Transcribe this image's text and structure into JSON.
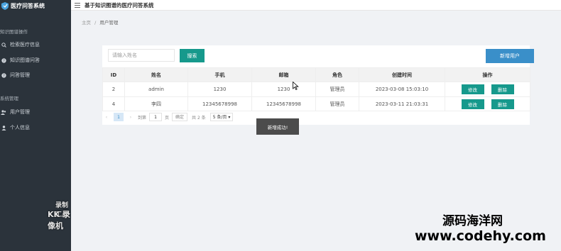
{
  "sidebar": {
    "app_title": "医疗问答系统",
    "groups": [
      {
        "title": "知识图谱操作",
        "items": [
          {
            "label": "检索医疗信息",
            "icon": "search-icon"
          },
          {
            "label": "知识图谱问答",
            "icon": "question-icon"
          },
          {
            "label": "问答管理",
            "icon": "question-icon"
          }
        ]
      },
      {
        "title": "系统管理",
        "items": [
          {
            "label": "用户管理",
            "icon": "users-icon"
          },
          {
            "label": "个人信息",
            "icon": "user-icon"
          }
        ]
      }
    ],
    "watermark_line1": "录制工具",
    "watermark_line2": "KK 录像机"
  },
  "header": {
    "system_title": "基于知识图谱的医疗问答系统"
  },
  "breadcrumb": {
    "home": "主页",
    "separator": "/",
    "current": "用户管理"
  },
  "toolbar": {
    "search_placeholder": "请输入姓名",
    "search_label": "搜索",
    "add_label": "新增用户"
  },
  "table": {
    "columns": [
      "ID",
      "姓名",
      "手机",
      "邮箱",
      "角色",
      "创建时间",
      "操作"
    ],
    "rows": [
      {
        "id": "2",
        "name": "admin",
        "phone": "1230",
        "email": "1230",
        "role": "管理员",
        "created": "2023-03-08 15:03:10",
        "edit": "修改",
        "delete": "删除"
      },
      {
        "id": "4",
        "name": "李四",
        "phone": "12345678998",
        "email": "12345678998",
        "role": "管理员",
        "created": "2023-03-11 21:03:31",
        "edit": "修改",
        "delete": "删除"
      }
    ]
  },
  "pager": {
    "prev": "‹",
    "current": "1",
    "next": "›",
    "goto_label": "到第",
    "goto_value": "1",
    "page_unit": "页",
    "confirm": "确定",
    "total": "共 2 条",
    "page_size": "5 条/页"
  },
  "toast": {
    "message": "新增成功!"
  },
  "site_watermark": {
    "line1": "源码海洋网",
    "line2": "www.codehy.com"
  },
  "colors": {
    "sidebar_bg": "#2b333b",
    "primary": "#16998c",
    "add_button": "#3a8fc9"
  }
}
